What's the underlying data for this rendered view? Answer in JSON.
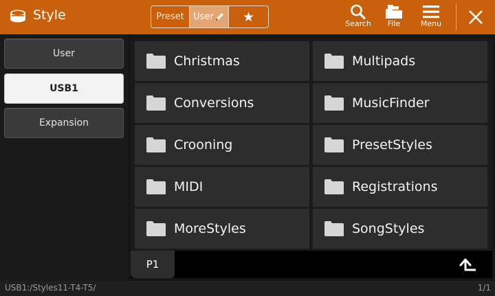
{
  "header": {
    "title": "Style",
    "app_icon": "drum-icon",
    "tabs": {
      "preset": "Preset",
      "user": "User",
      "favorite": "★"
    },
    "buttons": {
      "search": "Search",
      "file": "File",
      "menu": "Menu"
    },
    "close": "✕",
    "color": "#c8600c"
  },
  "sidebar": {
    "items": [
      {
        "label": "User",
        "selected": false
      },
      {
        "label": "USB1",
        "selected": true
      },
      {
        "label": "Expansion",
        "selected": false
      }
    ]
  },
  "folders": [
    "Christmas",
    "Multipads",
    "Conversions",
    "MusicFinder",
    "Crooning",
    "PresetStyles",
    "MIDI",
    "Registrations",
    "MoreStyles",
    "SongStyles"
  ],
  "pager": {
    "tab": "P1"
  },
  "status": {
    "path": "USB1:/Styles11-T4-T5/",
    "count": "1/1"
  }
}
